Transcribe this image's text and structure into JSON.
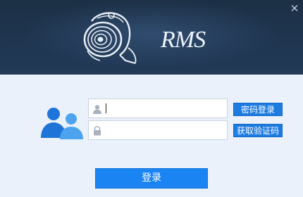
{
  "app": {
    "logo_text": "RMS",
    "close_icon": "close-icon"
  },
  "form": {
    "username": {
      "value": "",
      "placeholder": "",
      "icon": "user-icon"
    },
    "password": {
      "value": "",
      "placeholder": "",
      "icon": "lock-icon"
    },
    "password_login_label": "密码登录",
    "get_code_label": "获取验证码",
    "login_label": "登录"
  },
  "colors": {
    "header_bg": "#1f3550",
    "body_bg": "#eaf1fa",
    "accent": "#1a84f2",
    "users_icon": "#1f74d8"
  }
}
